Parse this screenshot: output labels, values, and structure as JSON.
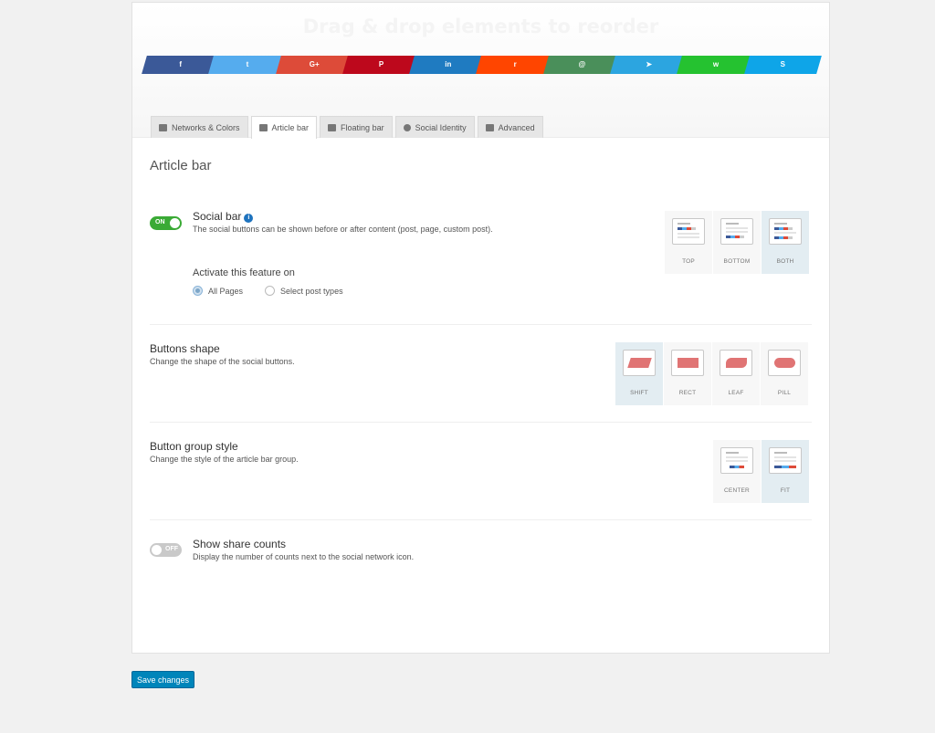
{
  "header": {
    "drag_title": "Drag & drop elements to reorder",
    "networks": [
      {
        "name": "facebook",
        "icon": "facebook-icon",
        "glyph": "f",
        "color": "#3b5998"
      },
      {
        "name": "twitter",
        "icon": "twitter-icon",
        "glyph": "t",
        "color": "#55acee"
      },
      {
        "name": "google-plus",
        "icon": "google-plus-icon",
        "glyph": "G+",
        "color": "#dd4b39"
      },
      {
        "name": "pinterest",
        "icon": "pinterest-icon",
        "glyph": "P",
        "color": "#bd081c"
      },
      {
        "name": "linkedin",
        "icon": "linkedin-icon",
        "glyph": "in",
        "color": "#1f7bc1"
      },
      {
        "name": "reddit",
        "icon": "reddit-icon",
        "glyph": "r",
        "color": "#ff4500"
      },
      {
        "name": "email",
        "icon": "envelope-icon",
        "glyph": "@",
        "color": "#4a8f5a"
      },
      {
        "name": "telegram",
        "icon": "telegram-icon",
        "glyph": "➤",
        "color": "#2ca5e0"
      },
      {
        "name": "whatsapp",
        "icon": "whatsapp-icon",
        "glyph": "w",
        "color": "#25c230"
      },
      {
        "name": "skype",
        "icon": "skype-icon",
        "glyph": "S",
        "color": "#0ea5e8"
      }
    ]
  },
  "tabs": [
    {
      "label": "Networks & Colors",
      "icon": "image-icon",
      "active": false
    },
    {
      "label": "Article bar",
      "icon": "article-bar-icon",
      "active": true
    },
    {
      "label": "Floating bar",
      "icon": "floating-bar-icon",
      "active": false
    },
    {
      "label": "Social Identity",
      "icon": "share-icon",
      "active": false
    },
    {
      "label": "Advanced",
      "icon": "advanced-icon",
      "active": false
    }
  ],
  "section_title": "Article bar",
  "social_bar": {
    "toggle_label": "ON",
    "title": "Social bar",
    "description": "The social buttons can be shown before or after content (post, page, custom post).",
    "activate_label": "Activate this feature on",
    "radio_all": "All Pages",
    "radio_select": "Select post types",
    "radio_selected": "All Pages",
    "positions": [
      "TOP",
      "BOTTOM",
      "BOTH"
    ],
    "selected_position": "BOTH"
  },
  "buttons_shape": {
    "title": "Buttons shape",
    "description": "Change the shape of the social buttons.",
    "options": [
      "SHIFT",
      "RECT",
      "LEAF",
      "PILL"
    ],
    "selected": "SHIFT"
  },
  "group_style": {
    "title": "Button group style",
    "description": "Change the style of the article bar group.",
    "options": [
      "CENTER",
      "FIT"
    ],
    "selected": "FIT"
  },
  "share_counts": {
    "toggle_label": "OFF",
    "title": "Show share counts",
    "description": "Display the number of counts next to the social network icon."
  },
  "save_label": "Save changes",
  "colors": {
    "accent": "#0085ba",
    "toggle_on": "#3aaa35",
    "shape_fill": "#e07474"
  }
}
